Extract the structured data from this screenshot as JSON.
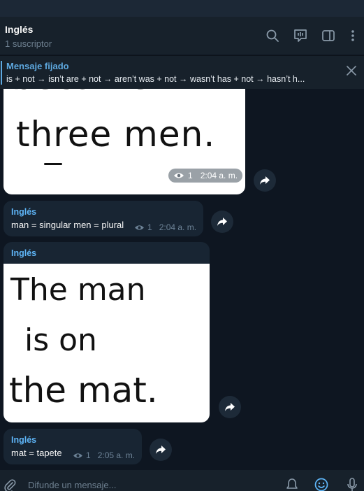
{
  "channel": {
    "title": "Inglés",
    "subtitle": "1 suscriptor"
  },
  "header_icons": [
    "search-icon",
    "live-stream-icon",
    "sidebar-toggle-icon",
    "more-vertical-icon"
  ],
  "pinned": {
    "label": "Mensaje fijado",
    "text": "is + not → isn’t  are + not → aren’t  was + not → wasn’t  has + not → hasn’t  h..."
  },
  "messages": [
    {
      "type": "image",
      "image_text_lines": [
        "became",
        "three men."
      ],
      "views": "1",
      "time": "2:04 a. m."
    },
    {
      "type": "text",
      "sender": "Inglés",
      "text": "man = singular men = plural",
      "views": "1",
      "time": "2:04 a. m."
    },
    {
      "type": "image",
      "sender": "Inglés",
      "image_text_lines": [
        "The man",
        "is on",
        "the mat."
      ]
    },
    {
      "type": "text",
      "sender": "Inglés",
      "text": "mat = tapete",
      "views": "1",
      "time": "2:05 a. m."
    }
  ],
  "composer": {
    "placeholder": "Difunde un mensaje..."
  },
  "colors": {
    "background": "#0e1621",
    "header": "#17212b",
    "bubble": "#182533",
    "accent": "#5eb5f7"
  }
}
